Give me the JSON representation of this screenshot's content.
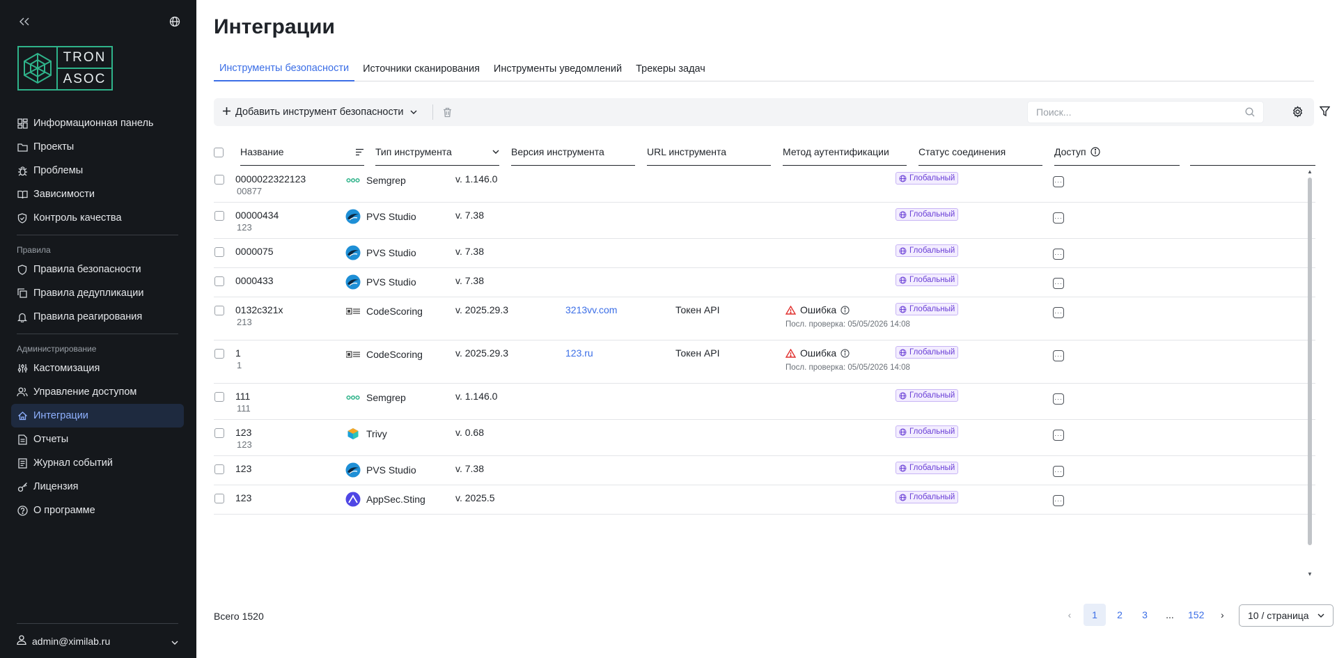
{
  "sidebar": {
    "logo_top": "TRON",
    "logo_bottom": "ASOC",
    "nav_main": [
      {
        "label": "Информационная панель",
        "icon": "dashboard-icon"
      },
      {
        "label": "Проекты",
        "icon": "folder-icon"
      },
      {
        "label": "Проблемы",
        "icon": "bug-icon"
      },
      {
        "label": "Зависимости",
        "icon": "book-icon"
      },
      {
        "label": "Контроль качества",
        "icon": "shield-check-icon"
      }
    ],
    "group_rules": "Правила",
    "nav_rules": [
      {
        "label": "Правила безопасности",
        "icon": "shield-icon"
      },
      {
        "label": "Правила дедупликации",
        "icon": "copy-icon"
      },
      {
        "label": "Правила реагирования",
        "icon": "bell-icon"
      }
    ],
    "group_admin": "Администрирование",
    "nav_admin": [
      {
        "label": "Кастомизация",
        "icon": "sliders-icon"
      },
      {
        "label": "Управление доступом",
        "icon": "users-icon"
      },
      {
        "label": "Интеграции",
        "icon": "integrations-icon"
      },
      {
        "label": "Отчеты",
        "icon": "document-icon"
      },
      {
        "label": "Журнал событий",
        "icon": "journal-icon"
      },
      {
        "label": "Лицензия",
        "icon": "key-icon"
      },
      {
        "label": "О программе",
        "icon": "question-icon"
      }
    ],
    "user": "admin@ximilab.ru"
  },
  "page": {
    "title": "Интеграции",
    "tabs": [
      "Инструменты безопасности",
      "Источники сканирования",
      "Инструменты уведомлений",
      "Трекеры задач"
    ]
  },
  "toolbar": {
    "add_label": "Добавить инструмент безопасности",
    "search_placeholder": "Поиск..."
  },
  "table": {
    "columns": [
      "Название",
      "Тип инструмента",
      "Версия инструмента",
      "URL инструмента",
      "Метод аутентификации",
      "Статус соединения",
      "Доступ"
    ],
    "rows": [
      {
        "name": "0000022322123",
        "sub": "00877",
        "tool": "Semgrep",
        "tool_icon": "semgrep",
        "version": "v. 1.146.0",
        "url": "",
        "auth": "",
        "status": "",
        "status_sub": "",
        "access": "Глобальный"
      },
      {
        "name": "00000434",
        "sub": "123",
        "tool": "PVS Studio",
        "tool_icon": "pvs",
        "version": "v. 7.38",
        "url": "",
        "auth": "",
        "status": "",
        "status_sub": "",
        "access": "Глобальный"
      },
      {
        "name": "0000075",
        "sub": "",
        "tool": "PVS Studio",
        "tool_icon": "pvs",
        "version": "v. 7.38",
        "url": "",
        "auth": "",
        "status": "",
        "status_sub": "",
        "access": "Глобальный"
      },
      {
        "name": "0000433",
        "sub": "",
        "tool": "PVS Studio",
        "tool_icon": "pvs",
        "version": "v. 7.38",
        "url": "",
        "auth": "",
        "status": "",
        "status_sub": "",
        "access": "Глобальный"
      },
      {
        "name": "0132c321x",
        "sub": "213",
        "tool": "CodeScoring",
        "tool_icon": "codescoring",
        "version": "v. 2025.29.3",
        "url": "3213vv.com",
        "auth": "Токен API",
        "status": "Ошибка",
        "status_sub": "Посл. проверка: 05/05/2026 14:08",
        "access": "Глобальный"
      },
      {
        "name": "1",
        "sub": "1",
        "tool": "CodeScoring",
        "tool_icon": "codescoring",
        "version": "v. 2025.29.3",
        "url": "123.ru",
        "auth": "Токен API",
        "status": "Ошибка",
        "status_sub": "Посл. проверка: 05/05/2026 14:08",
        "access": "Глобальный"
      },
      {
        "name": "111",
        "sub": "111",
        "tool": "Semgrep",
        "tool_icon": "semgrep",
        "version": "v. 1.146.0",
        "url": "",
        "auth": "",
        "status": "",
        "status_sub": "",
        "access": "Глобальный"
      },
      {
        "name": "123",
        "sub": "123",
        "tool": "Trivy",
        "tool_icon": "trivy",
        "version": "v. 0.68",
        "url": "",
        "auth": "",
        "status": "",
        "status_sub": "",
        "access": "Глобальный"
      },
      {
        "name": "123",
        "sub": "",
        "tool": "PVS Studio",
        "tool_icon": "pvs",
        "version": "v. 7.38",
        "url": "",
        "auth": "",
        "status": "",
        "status_sub": "",
        "access": "Глобальный"
      },
      {
        "name": "123",
        "sub": "",
        "tool": "AppSec.Sting",
        "tool_icon": "appsec",
        "version": "v. 2025.5",
        "url": "",
        "auth": "",
        "status": "",
        "status_sub": "",
        "access": "Глобальный"
      }
    ]
  },
  "footer": {
    "total": "Всего 1520",
    "pages": [
      "1",
      "2",
      "3",
      "...",
      "152"
    ],
    "current_page": "1",
    "page_size": "10 / страница"
  },
  "colors": {
    "accent": "#3b6ee6",
    "sidebar_bg": "#15181c",
    "logo_green": "#2fb38a",
    "error": "#e0302e",
    "badge": "#6a3fd6"
  }
}
